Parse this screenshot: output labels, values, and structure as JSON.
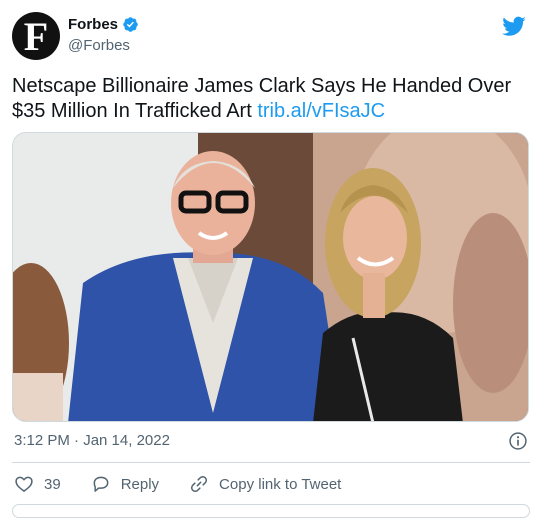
{
  "author": {
    "display_name": "Forbes",
    "handle": "@Forbes",
    "avatar_letter": "F",
    "verified": true
  },
  "tweet": {
    "text": "Netscape Billionaire James Clark Says He Handed Over $35 Million In Trafficked Art",
    "link": "trib.al/vFIsaJC"
  },
  "meta": {
    "timestamp": "3:12 PM · Jan 14, 2022"
  },
  "actions": {
    "like_count": "39",
    "reply_label": "Reply",
    "copy_label": "Copy link to Tweet"
  },
  "colors": {
    "accent": "#1d9bf0",
    "text": "#0f1419",
    "muted": "#536471",
    "border": "#cfd9de"
  },
  "icons": [
    "twitter-bird-icon",
    "verified-badge-icon",
    "info-icon",
    "heart-icon",
    "reply-icon",
    "link-icon"
  ]
}
